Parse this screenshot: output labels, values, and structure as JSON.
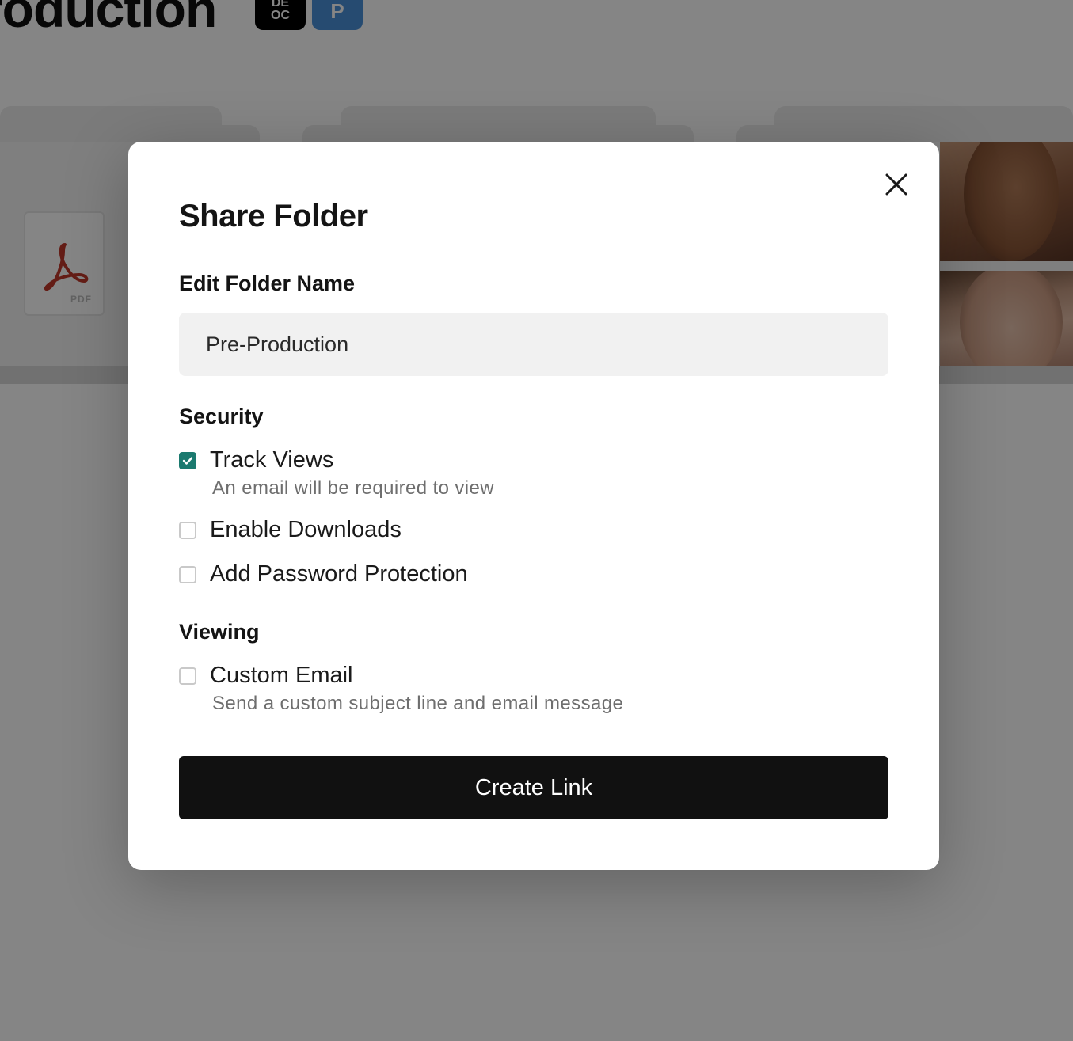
{
  "background": {
    "page_title": "roduction",
    "avatar_black": {
      "line1": "DE",
      "line2": "OC"
    },
    "avatar_blue": "P",
    "pdf_label": "PDF"
  },
  "modal": {
    "title": "Share Folder",
    "name_section_label": "Edit Folder Name",
    "folder_name_value": "Pre-Production",
    "security": {
      "heading": "Security",
      "options": [
        {
          "label": "Track Views",
          "help": "An email will be required to view",
          "checked": true
        },
        {
          "label": "Enable Downloads",
          "help": "",
          "checked": false
        },
        {
          "label": "Add Password Protection",
          "help": "",
          "checked": false
        }
      ]
    },
    "viewing": {
      "heading": "Viewing",
      "options": [
        {
          "label": "Custom Email",
          "help": "Send a custom subject line and email message",
          "checked": false
        }
      ]
    },
    "create_button_label": "Create Link"
  },
  "colors": {
    "accent": "#1b7a6f",
    "button_bg": "#111111",
    "input_bg": "#f1f1f1"
  },
  "icons": {
    "close": "close-icon",
    "check": "check-icon",
    "pdf": "pdf-icon"
  }
}
